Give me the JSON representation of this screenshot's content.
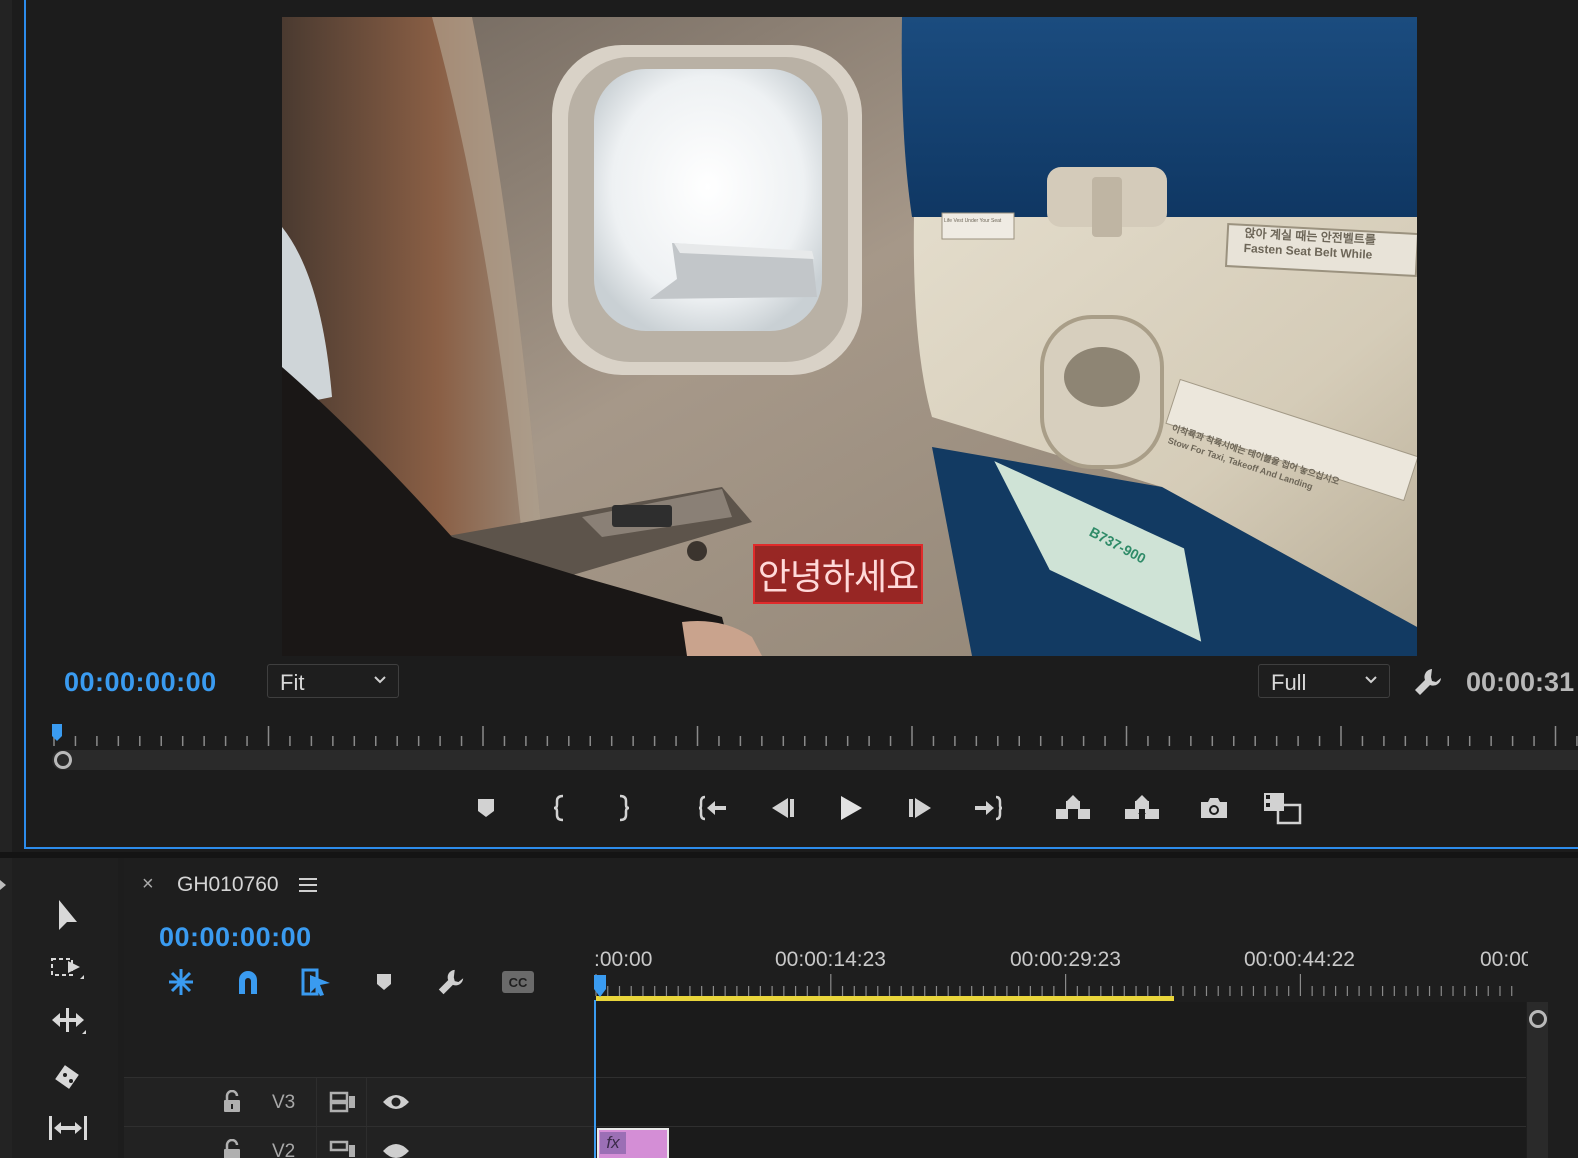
{
  "program_monitor": {
    "playhead_timecode": "00:00:00:00",
    "duration_timecode": "00:00:31",
    "zoom_value": "Fit",
    "resolution_value": "Full",
    "subtitle_text": "안녕하세요",
    "seat_placard_ko": "앉아 계실 때는 안전벨트를",
    "seat_placard_en": "Fasten Seat Belt While",
    "tray_label_ko": "이착륙과 착륙시에는 테이블을 접어 놓으십시오",
    "tray_label_en": "Stow For Taxi, Takeoff And Landing",
    "card_label": "B737-900",
    "life_vest_label": "Life Vest Under Your Seat"
  },
  "transport_buttons": [
    {
      "icon": "add-marker-icon"
    },
    {
      "icon": "mark-in-icon"
    },
    {
      "icon": "mark-out-icon"
    },
    {
      "icon": "go-to-in-icon"
    },
    {
      "icon": "step-back-icon"
    },
    {
      "icon": "play-icon"
    },
    {
      "icon": "step-forward-icon"
    },
    {
      "icon": "go-to-out-icon"
    },
    {
      "icon": "lift-icon"
    },
    {
      "icon": "extract-icon"
    },
    {
      "icon": "export-frame-icon"
    },
    {
      "icon": "comparison-view-icon"
    }
  ],
  "timeline": {
    "sequence_name": "GH010760",
    "playhead_timecode": "00:00:00:00",
    "ruler_labels": [
      ":00:00",
      "00:00:14:23",
      "00:00:29:23",
      "00:00:44:22",
      "00:00"
    ],
    "tracks": [
      {
        "label": "V3"
      },
      {
        "label": "V2"
      }
    ],
    "clip_badge": "fx"
  },
  "colors": {
    "accent_blue": "#3a9bf0",
    "work_area_yellow": "#e9d53b",
    "clip_pink": "#d48ed6",
    "subtitle_red": "#b01e1e"
  }
}
